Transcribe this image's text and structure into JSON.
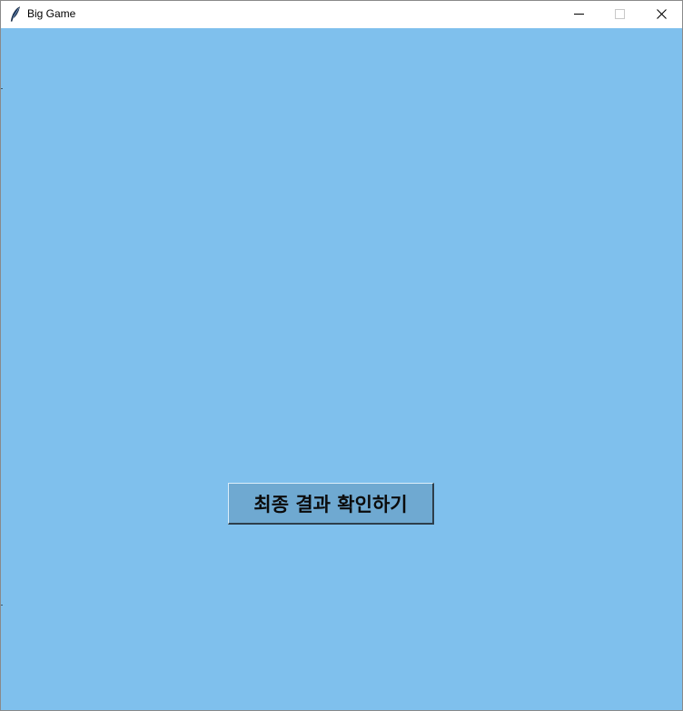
{
  "window": {
    "title": "Big Game",
    "icon": "feather-icon",
    "controls": [
      "minimize-icon",
      "maximize-icon",
      "close-icon"
    ]
  },
  "client": {
    "background_color": "#7fc0ed"
  },
  "final_button": {
    "label": "최종 결과 확인하기",
    "background_color": "#6fa9d1"
  }
}
